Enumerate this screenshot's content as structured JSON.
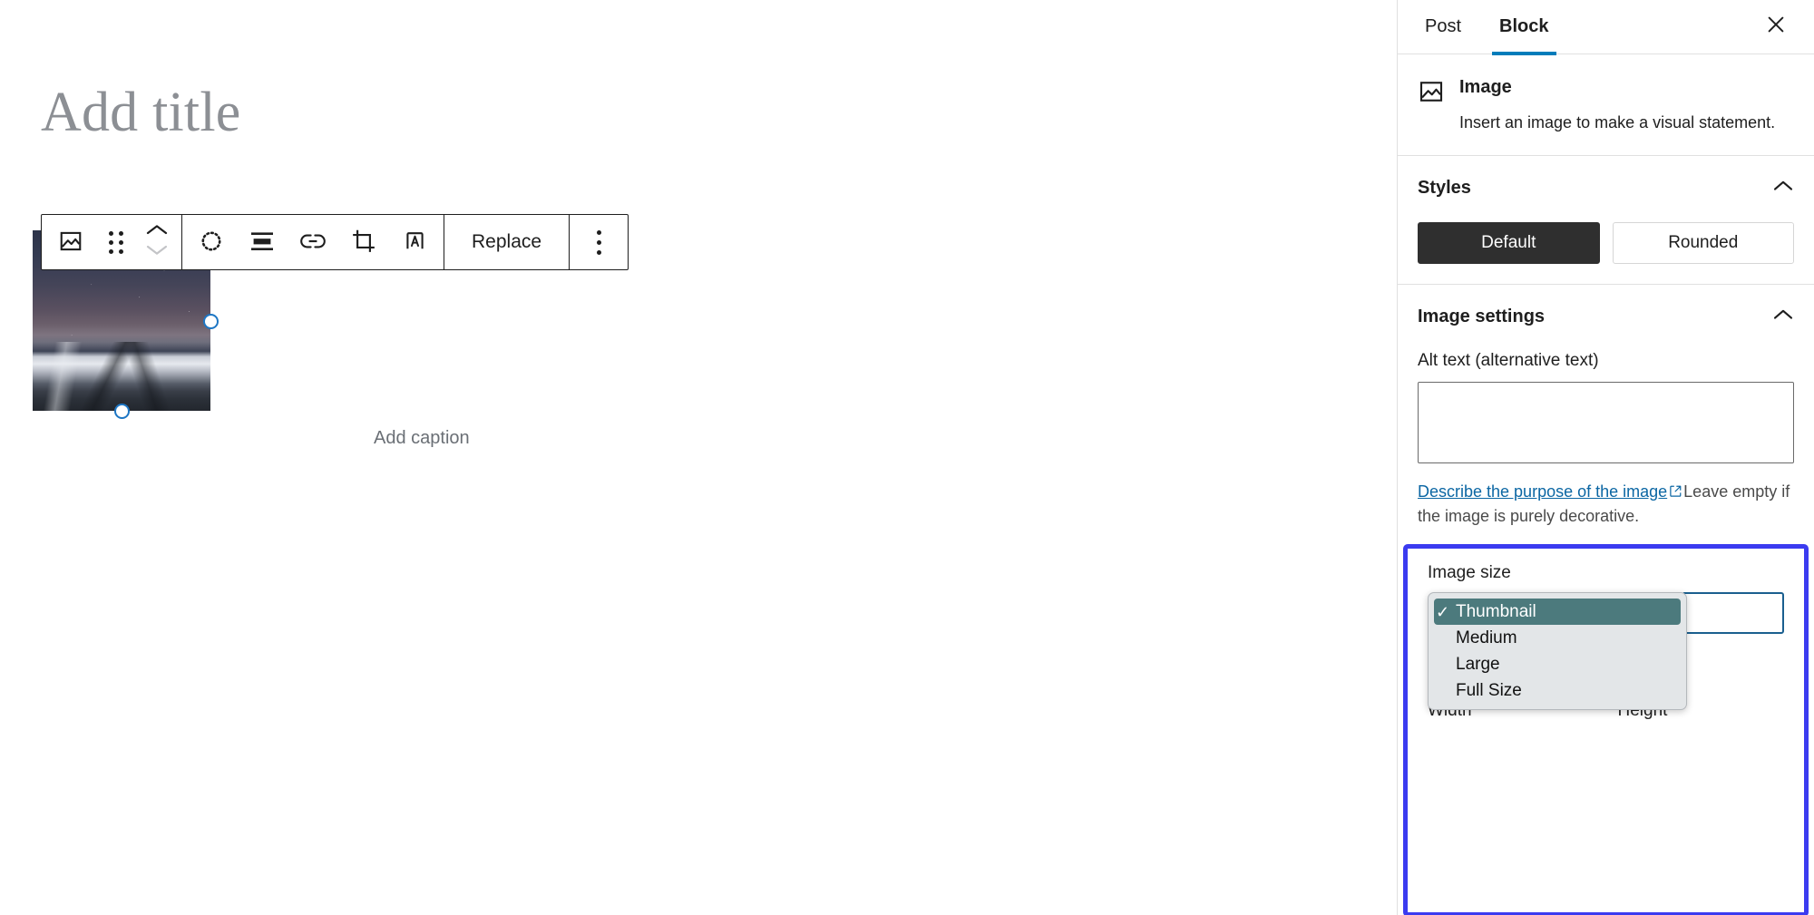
{
  "editor": {
    "title_placeholder": "Add title",
    "caption_placeholder": "Add caption"
  },
  "toolbar": {
    "block_type_icon": "image-icon",
    "drag_icon": "drag-handle-icon",
    "move_up_icon": "chevron-up-icon",
    "move_down_icon": "chevron-down-icon",
    "align_icon": "align-options-icon",
    "align_center_icon": "align-center-icon",
    "link_icon": "link-icon",
    "crop_icon": "crop-icon",
    "text_over_image_icon": "add-text-over-image-icon",
    "replace_label": "Replace",
    "more_options_icon": "more-options-icon"
  },
  "sidebar": {
    "tabs": [
      {
        "label": "Post",
        "active": false
      },
      {
        "label": "Block",
        "active": true
      }
    ],
    "close_icon": "close-icon",
    "block_card": {
      "icon": "image-icon",
      "title": "Image",
      "description": "Insert an image to make a visual statement."
    },
    "styles_panel": {
      "title": "Styles",
      "toggle_icon": "chevron-up-icon",
      "options": [
        {
          "label": "Default",
          "selected": true
        },
        {
          "label": "Rounded",
          "selected": false
        }
      ]
    },
    "image_settings_panel": {
      "title": "Image settings",
      "toggle_icon": "chevron-up-icon",
      "alt_text_label": "Alt text (alternative text)",
      "alt_text_value": "",
      "alt_text_placeholder": "",
      "help_link_text": "Describe the purpose of the image",
      "help_link_icon": "external-link-icon",
      "help_rest_text": "Leave empty if the image is purely decorative."
    },
    "image_size": {
      "label": "Image size",
      "selected_value": "Thumbnail",
      "highlight_color": "#3b3bf0",
      "selected_row_color": "#4c7a7d",
      "check_icon": "check-icon",
      "options": [
        {
          "label": "Thumbnail",
          "selected": true
        },
        {
          "label": "Medium",
          "selected": false
        },
        {
          "label": "Large",
          "selected": false
        },
        {
          "label": "Full Size",
          "selected": false
        }
      ]
    },
    "dimensions": {
      "width_label": "Width",
      "height_label": "Height"
    }
  },
  "colors": {
    "accent": "#007cba",
    "handle": "#1d76c4",
    "link": "#0b66a3"
  }
}
